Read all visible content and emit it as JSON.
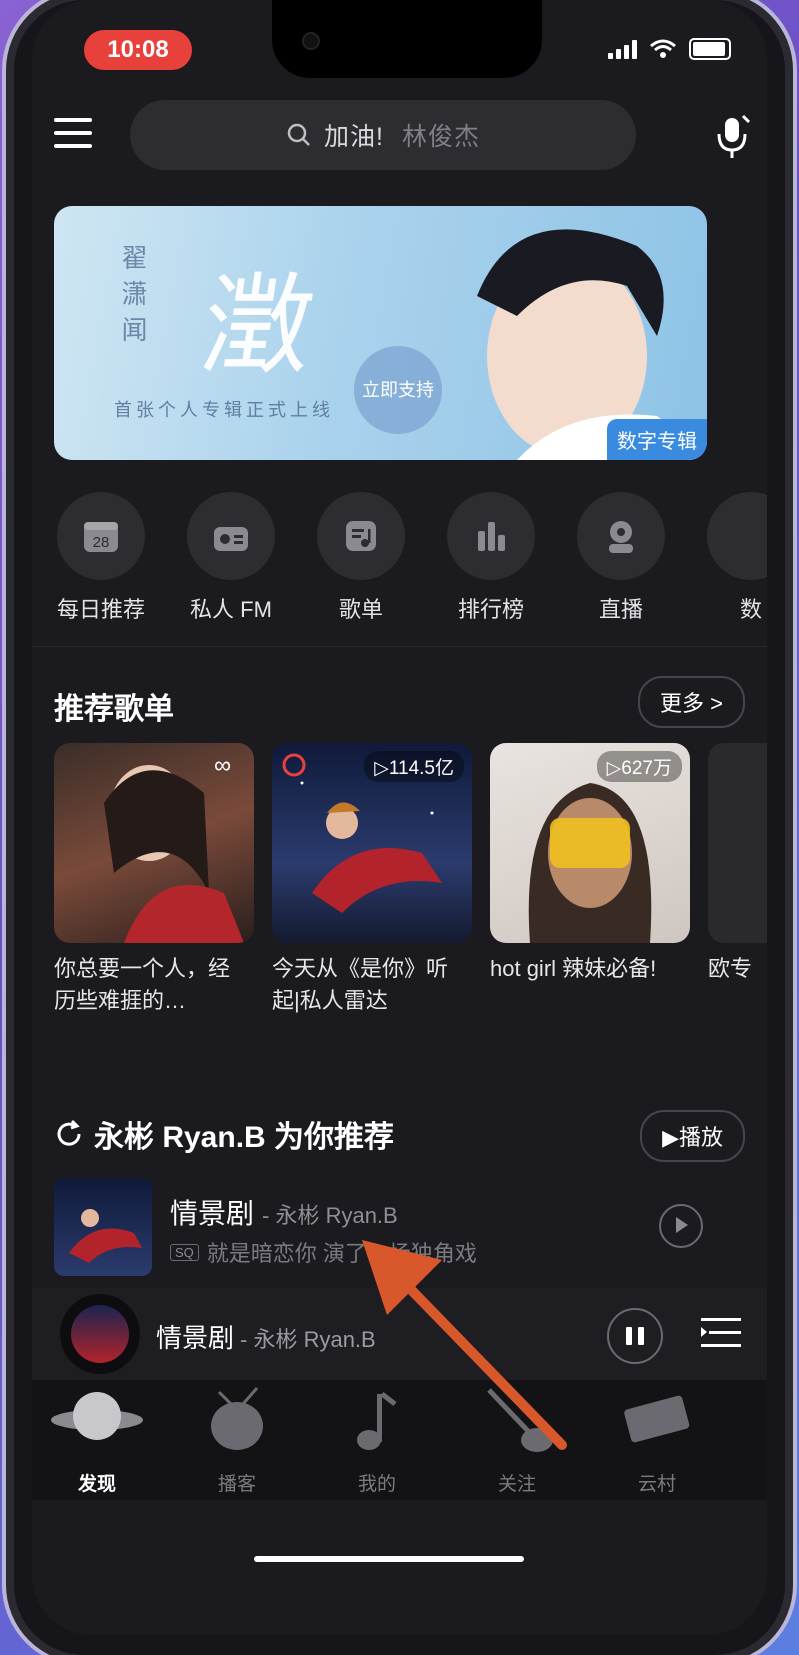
{
  "status": {
    "time": "10:08"
  },
  "search": {
    "text": "加油!",
    "hint": "林俊杰"
  },
  "banner": {
    "vertical_title": "翟潇闻",
    "big_text": "澂",
    "subtitle": "首张个人专辑正式上线",
    "support_button": "立即支持",
    "tag": "数字专辑"
  },
  "quick_actions": [
    {
      "label": "每日推荐",
      "icon": "calendar-icon"
    },
    {
      "label": "私人 FM",
      "icon": "radio-icon"
    },
    {
      "label": "歌单",
      "icon": "playlist-icon"
    },
    {
      "label": "排行榜",
      "icon": "chart-icon"
    },
    {
      "label": "直播",
      "icon": "live-icon"
    },
    {
      "label": "数",
      "icon": "more-icon"
    }
  ],
  "playlists": {
    "title": "推荐歌单",
    "more": "更多 >",
    "items": [
      {
        "title": "你总要一个人，经历些难捱的…",
        "count": ""
      },
      {
        "title": "今天从《是你》听起|私人雷达",
        "count": "▷114.5亿"
      },
      {
        "title": "hot girl 辣妹必备!",
        "count": "▷627万"
      },
      {
        "title": "欧专",
        "count": ""
      }
    ]
  },
  "recommend": {
    "title": "永彬 Ryan.B 为你推荐",
    "play_button": "▶播放",
    "song": {
      "name": "情景剧",
      "artist": "- 永彬 Ryan.B",
      "quality": "SQ",
      "lyric": "就是暗恋你 演了一场独角戏"
    }
  },
  "mini_player": {
    "title": "情景剧",
    "artist": "- 永彬 Ryan.B"
  },
  "tabs": [
    {
      "label": "发现",
      "icon": "planet-icon"
    },
    {
      "label": "播客",
      "icon": "tv-icon"
    },
    {
      "label": "我的",
      "icon": "music-note-icon"
    },
    {
      "label": "关注",
      "icon": "guitar-icon"
    },
    {
      "label": "云村",
      "icon": "keyboard-icon"
    }
  ],
  "colors": {
    "accent": "#e8413c",
    "background": "#1b1b1f",
    "annotation_arrow": "#d9582b"
  }
}
